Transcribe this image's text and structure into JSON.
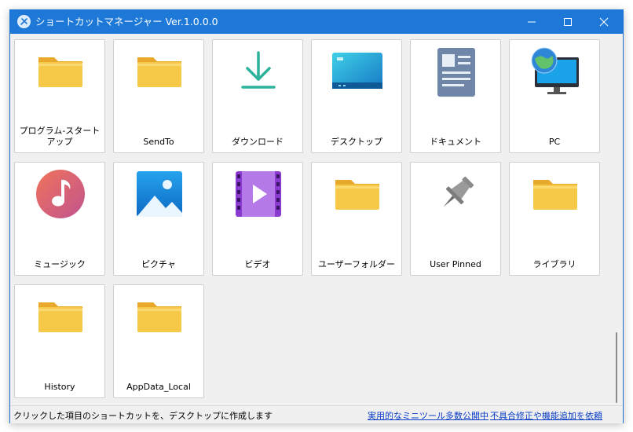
{
  "window": {
    "title": "ショートカットマネージャー Ver.1.0.0.0"
  },
  "tiles": [
    {
      "label": "プログラム-スタートアップ",
      "icon": "folder-icon"
    },
    {
      "label": "SendTo",
      "icon": "folder-icon"
    },
    {
      "label": "ダウンロード",
      "icon": "download-icon"
    },
    {
      "label": "デスクトップ",
      "icon": "desktop-icon"
    },
    {
      "label": "ドキュメント",
      "icon": "document-icon"
    },
    {
      "label": "PC",
      "icon": "pc-icon"
    },
    {
      "label": "ミュージック",
      "icon": "music-icon"
    },
    {
      "label": "ピクチャ",
      "icon": "pictures-icon"
    },
    {
      "label": "ビデオ",
      "icon": "video-icon"
    },
    {
      "label": "ユーザーフォルダー",
      "icon": "folder-icon"
    },
    {
      "label": "User Pinned",
      "icon": "pin-icon"
    },
    {
      "label": "ライブラリ",
      "icon": "folder-icon"
    },
    {
      "label": "History",
      "icon": "folder-icon"
    },
    {
      "label": "AppData_Local",
      "icon": "folder-icon"
    }
  ],
  "statusbar": {
    "text": "クリックした項目のショートカットを、デスクトップに作成します",
    "link1": "実用的なミニツール多数公開中",
    "link2": "不具合修正や機能追加を依頼"
  },
  "colors": {
    "titlebar": "#1e78d7",
    "folder": "#f7c948",
    "link": "#0a3cc8"
  }
}
